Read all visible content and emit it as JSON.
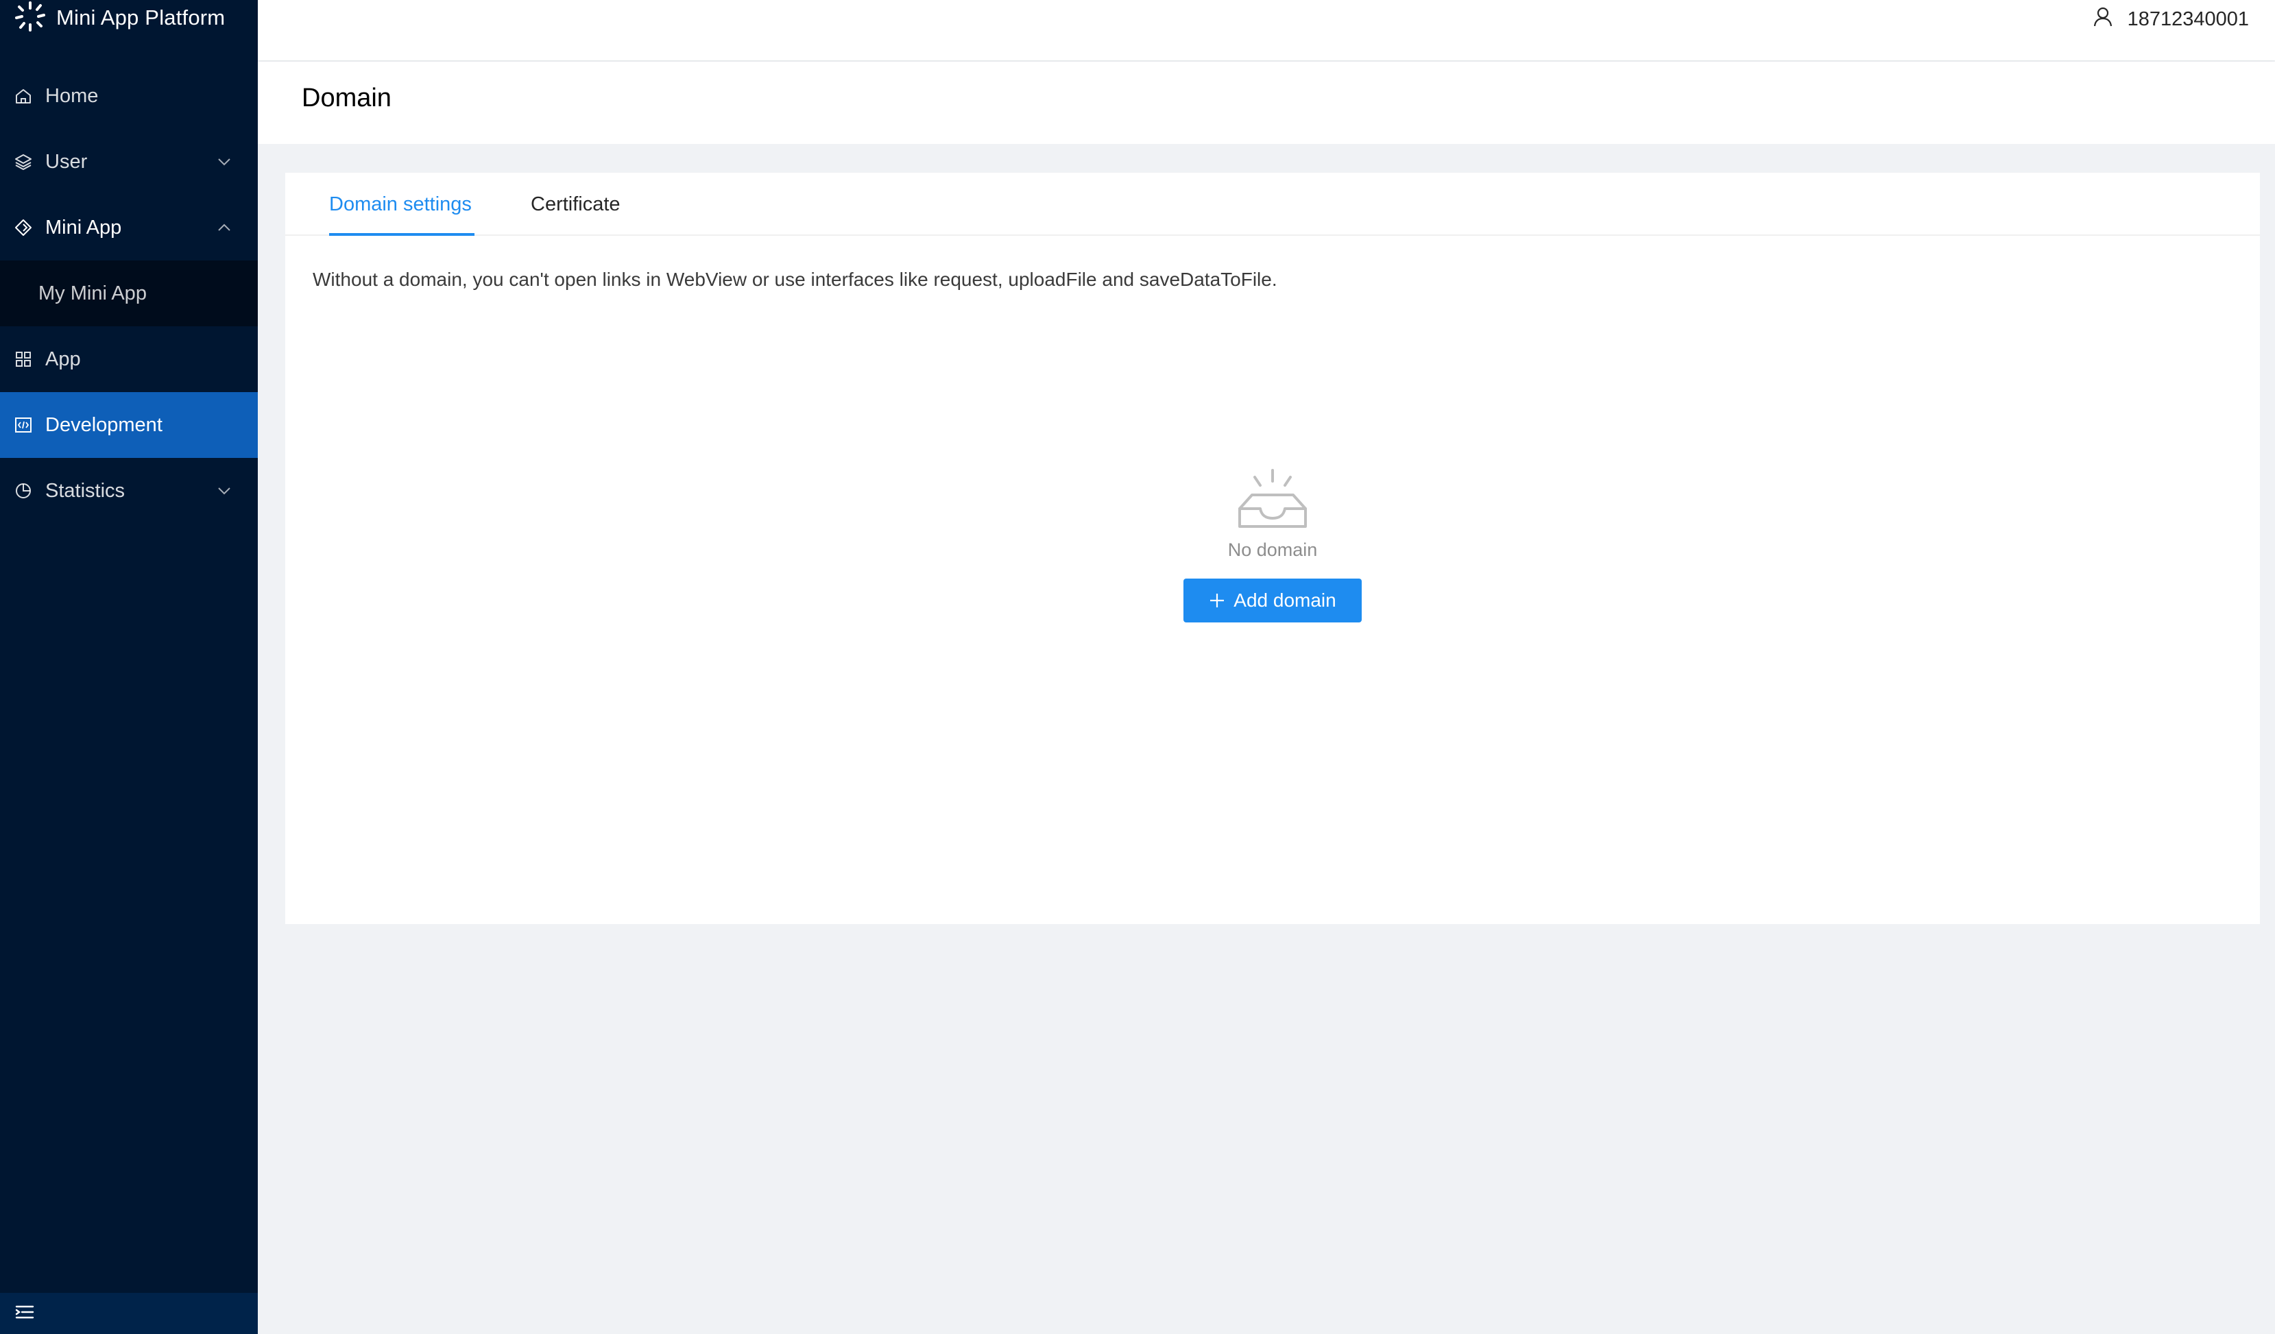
{
  "app": {
    "title": "Mini App Platform",
    "logo_icon": "spark-logo-icon",
    "colors": {
      "sidebar_bg": "#001631",
      "active_item": "#0e5fb8",
      "accent": "#1e8cf0",
      "page_bg": "#f0f2f5"
    }
  },
  "sidebar": {
    "items": [
      {
        "label": "Home",
        "icon": "home-icon"
      },
      {
        "label": "User",
        "icon": "layers-icon",
        "expandable": true,
        "expanded": false
      },
      {
        "label": "Mini App",
        "icon": "diamond-icon",
        "expandable": true,
        "expanded": true
      },
      {
        "label": "My Mini App",
        "submenu": true
      },
      {
        "label": "App",
        "icon": "grid-icon"
      },
      {
        "label": "Development",
        "icon": "code-icon",
        "active": true
      },
      {
        "label": "Statistics",
        "icon": "pie-chart-icon",
        "expandable": true,
        "expanded": false
      }
    ],
    "footer_icon": "menu-fold-icon"
  },
  "header": {
    "user_icon": "user-icon",
    "username": "18712340001"
  },
  "page": {
    "title": "Domain"
  },
  "tabs": [
    {
      "label": "Domain settings",
      "active": true
    },
    {
      "label": "Certificate",
      "active": false
    }
  ],
  "content": {
    "hint": "Without a domain, you can't open links in WebView or use interfaces like request, uploadFile and saveDataToFile.",
    "empty_icon": "empty-inbox-icon",
    "empty_text": "No domain",
    "add_button": {
      "label": "Add domain",
      "icon": "plus-icon"
    }
  }
}
